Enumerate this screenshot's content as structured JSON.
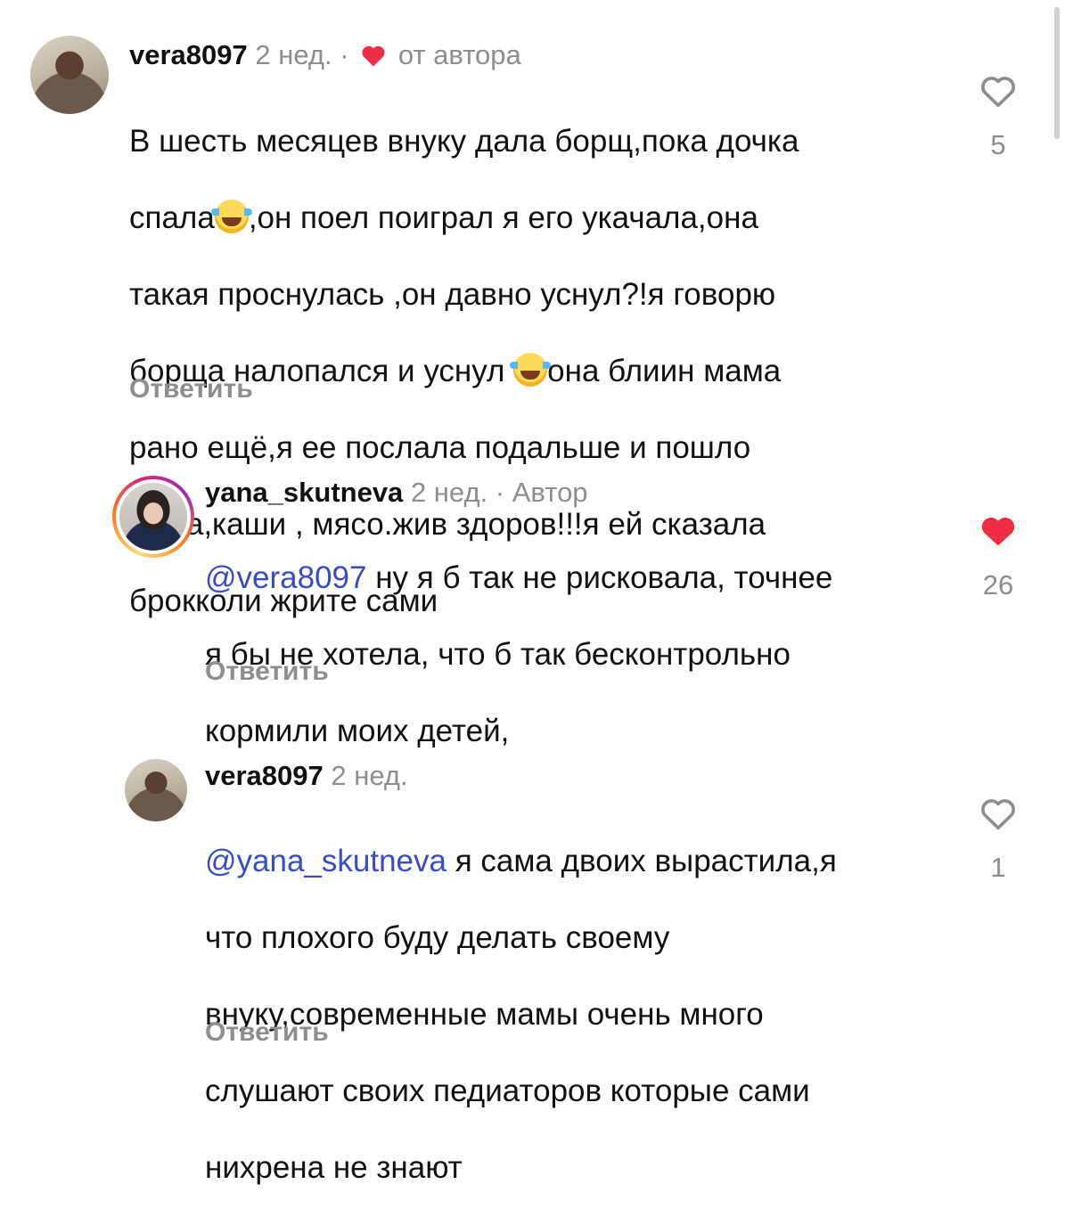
{
  "comments": [
    {
      "username": "vera8097",
      "time": "2 нед.",
      "separator": "·",
      "author_like_label": "от автора",
      "text_line1": "В шесть месяцев внуку дала борщ,пока дочка",
      "text_line2a": "спала",
      "text_line2b": ",он поел поиграл я его укачала,она",
      "text_line3": "такая проснулась ,он давно уснул?!я говорю",
      "text_line4a": "борща налопался и уснул ",
      "text_line4b": "она блиин мама",
      "text_line5": "рано ещё,я ее послала подальше и пошло",
      "text_line6": "рыба,каши , мясо.жив здоров!!!я ей сказала",
      "text_line7": "брокколи жрите сами",
      "reply_label": "Ответить",
      "likes": "5",
      "liked": false
    },
    {
      "username": "yana_skutneva",
      "time": "2 нед.",
      "separator": "·",
      "author_tag": "Автор",
      "mention": "@vera8097",
      "text_line1": " ну я б так не рисковала, точнее",
      "text_line2": "я бы не хотела, что б так бесконтрольно",
      "text_line3": "кормили моих детей,",
      "reply_label": "Ответить",
      "likes": "26",
      "liked": true
    },
    {
      "username": "vera8097",
      "time": "2 нед.",
      "mention": "@yana_skutneva",
      "text_line1": " я сама двоих вырастила,я",
      "text_line2": "что плохого буду делать своему",
      "text_line3": "внуку,современные мамы очень много",
      "text_line4": "слушают своих педиаторов которые сами",
      "text_line5": "нихрена не знают",
      "reply_label": "Ответить",
      "likes": "1",
      "liked": false
    }
  ],
  "colors": {
    "like_red": "#ed2c46",
    "mention_blue": "#3b4bc8",
    "secondary_gray": "#8e8e8e"
  },
  "icons": [
    "heart-outline-icon",
    "heart-filled-icon",
    "crying-laughing-emoji"
  ]
}
